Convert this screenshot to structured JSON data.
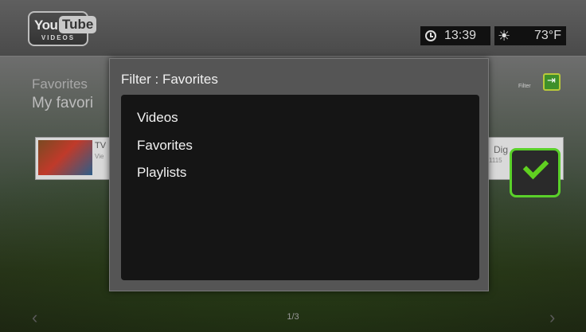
{
  "app": {
    "logo_you": "You",
    "logo_tube": "Tube",
    "logo_sub": "VIDEOS"
  },
  "status": {
    "time": "13:39",
    "temperature": "73°F",
    "clock_icon": "clock-icon",
    "weather_icon": "sun-cloud-icon"
  },
  "background": {
    "title": "Favorites",
    "subtitle": "My favori",
    "filter_label": "Filter",
    "card_left_title": "TV",
    "card_left_sub": "Vie",
    "card_right_title": "Dig",
    "card_right_sub": "1115",
    "page": "1/3"
  },
  "dialog": {
    "title": "Filter : Favorites",
    "options": [
      "Videos",
      "Favorites",
      "Playlists"
    ],
    "confirm_icon": "checkmark-icon"
  },
  "colors": {
    "accent": "#5ad02a",
    "dialog_bg": "#555555",
    "list_bg": "#151515"
  }
}
